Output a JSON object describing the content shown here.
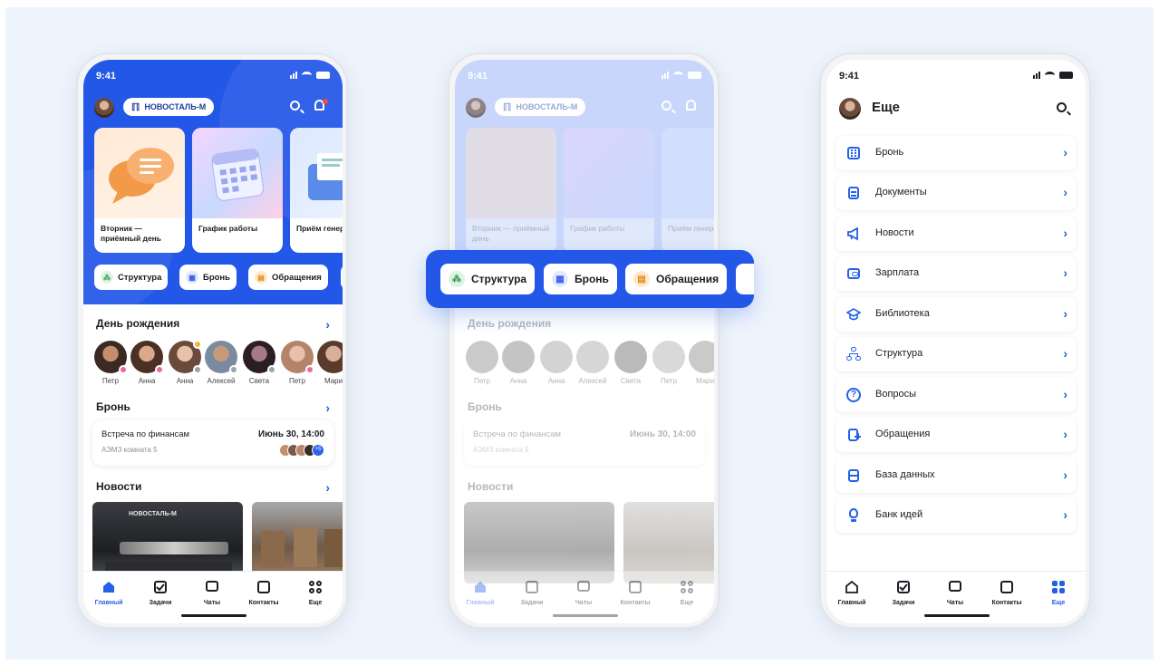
{
  "status_time": "9:41",
  "brand": "НОВОСТАЛЬ-М",
  "colors": {
    "primary": "#2257e8",
    "accent": "#2460e8",
    "background": "#eef4fc"
  },
  "home": {
    "cards": [
      {
        "label": "Вторник — приёмный день",
        "icon": "chat-bubbles-icon"
      },
      {
        "label": "График работы",
        "icon": "calendar-icon"
      },
      {
        "label": "Приём генерального",
        "icon": "folder-icon"
      }
    ],
    "chips": [
      {
        "label": "Структура",
        "icon": "structure-icon"
      },
      {
        "label": "Бронь",
        "icon": "building-icon"
      },
      {
        "label": "Обращения",
        "icon": "document-icon"
      }
    ],
    "birthday": {
      "title": "День рождения",
      "people": [
        "Петр",
        "Анна",
        "Анна",
        "Алексей",
        "Света",
        "Петр",
        "Мари"
      ]
    },
    "booking": {
      "title": "Бронь",
      "meeting_name": "Встреча по финансам",
      "meeting_room": "АЭМЗ комната 5",
      "meeting_date": "Июнь 30, 14:00",
      "extra_count": "+5"
    },
    "news": {
      "title": "Новости",
      "sign_text": "НОВОСТАЛЬ-М"
    }
  },
  "nav": [
    {
      "label": "Главный",
      "icon": "home-icon"
    },
    {
      "label": "Задачи",
      "icon": "tasks-icon"
    },
    {
      "label": "Чаты",
      "icon": "chat-icon"
    },
    {
      "label": "Контакты",
      "icon": "contacts-icon"
    },
    {
      "label": "Еще",
      "icon": "grid-icon"
    }
  ],
  "more": {
    "title": "Еще",
    "items": [
      {
        "label": "Бронь",
        "icon": "building-icon"
      },
      {
        "label": "Документы",
        "icon": "document-icon"
      },
      {
        "label": "Новости",
        "icon": "megaphone-icon"
      },
      {
        "label": "Зарплата",
        "icon": "wallet-icon"
      },
      {
        "label": "Библиотека",
        "icon": "graduation-cap-icon"
      },
      {
        "label": "Структура",
        "icon": "structure-icon"
      },
      {
        "label": "Вопросы",
        "icon": "question-icon"
      },
      {
        "label": "Обращения",
        "icon": "document-icon"
      },
      {
        "label": "База данных",
        "icon": "database-icon"
      },
      {
        "label": "Банк идей",
        "icon": "lightbulb-icon"
      }
    ]
  }
}
